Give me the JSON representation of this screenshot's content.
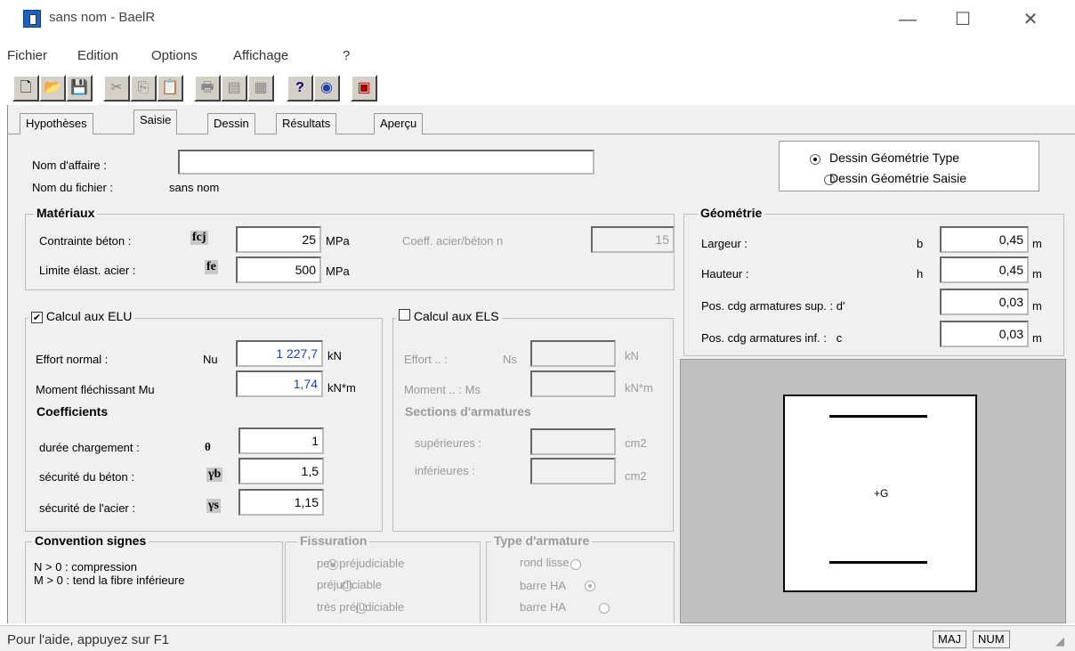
{
  "window": {
    "title": "sans nom - BaelR",
    "minimize": "—",
    "maximize": "☐",
    "close": "✕"
  },
  "menu": [
    "Fichier",
    "Edition",
    "Options",
    "Affichage",
    "?"
  ],
  "toolbar": {
    "icons": [
      "new-icon",
      "open-icon",
      "save-icon",
      "cut-icon",
      "copy-icon",
      "paste-icon",
      "print-icon",
      "print-preview-icon",
      "page-setup-icon",
      "help-icon",
      "globe-icon",
      "calculator-icon"
    ],
    "help_label": "?"
  },
  "tabs": [
    "Hypothèses",
    "Saisie",
    "Dessin",
    "Résultats",
    "Aperçu"
  ],
  "active_tab": "Saisie",
  "affaire": {
    "label": "Nom d'affaire :",
    "value": "",
    "file_label": "Nom du fichier :",
    "file_value": "sans nom"
  },
  "dessin_mode": {
    "option1": "Dessin Géométrie Type",
    "option2": "Dessin Géométrie Saisie",
    "selected": "Dessin Géométrie Type"
  },
  "materiaux": {
    "title": "Matériaux",
    "beton_label": "Contrainte béton :",
    "beton_sym": "fcj",
    "beton_value": "25",
    "beton_unit": "MPa",
    "acier_label": "Limite élast. acier :",
    "acier_sym": "fe",
    "acier_value": "500",
    "acier_unit": "MPa",
    "coeff_label": "Coeff. acier/béton  n",
    "coeff_value": "15"
  },
  "geometrie": {
    "title": "Géométrie",
    "largeur_label": "Largeur :",
    "largeur_sym": "b",
    "largeur_value": "0,45",
    "largeur_unit": "m",
    "hauteur_label": "Hauteur :",
    "hauteur_sym": "h",
    "hauteur_value": "0,45",
    "hauteur_unit": "m",
    "sup_label": "Pos. cdg armatures sup. : d'",
    "sup_value": "0,03",
    "sup_unit": "m",
    "inf_label": "Pos. cdg armatures inf. :   c",
    "inf_value": "0,03",
    "inf_unit": "m",
    "drawing_label": "+G"
  },
  "elu": {
    "title": "Calcul aux ELU",
    "checked": true,
    "effort_label": "Effort normal :",
    "effort_sym": "Nu",
    "effort_value": "1 227,7",
    "effort_unit": "kN",
    "moment_label": "Moment fléchissant  Mu",
    "moment_value": "1,74",
    "moment_unit": "kN*m"
  },
  "els": {
    "title": "Calcul aux ELS",
    "checked": false,
    "effort_label": "Effort .. :",
    "effort_sym": "Ns",
    "effort_unit": "kN",
    "moment_label": "Moment .. : Ms",
    "moment_unit": "kN*m"
  },
  "coefficients": {
    "title": "Coefficients",
    "duree_label": "durée chargement :",
    "duree_sym": "θ",
    "duree_value": "1",
    "secb_label": "sécurité du béton :",
    "secb_sym": "γb",
    "secb_value": "1,5",
    "seca_label": "sécurité de l'acier :",
    "seca_sym": "γs",
    "seca_value": "1,15"
  },
  "sections": {
    "title": "Sections d'armatures",
    "sup_label": "supérieures :",
    "sup_unit": "cm2",
    "inf_label": "inférieures :",
    "inf_unit": "cm2"
  },
  "convention": {
    "title": "Convention signes",
    "line1": "N > 0 : compression",
    "line2": "M > 0 : tend la fibre inférieure"
  },
  "fissuration": {
    "title": "Fissuration",
    "options": [
      "peu préjudiciable",
      "préjudiciable",
      "très préjudiciable"
    ],
    "selected": "peu préjudiciable"
  },
  "armature": {
    "title": "Type d'armature",
    "options": [
      "rond lisse",
      "barre HA",
      "barre HA"
    ],
    "selected_index": 1
  },
  "status": {
    "text": "Pour l'aide, appuyez sur F1",
    "maj": "MAJ",
    "num": "NUM"
  }
}
